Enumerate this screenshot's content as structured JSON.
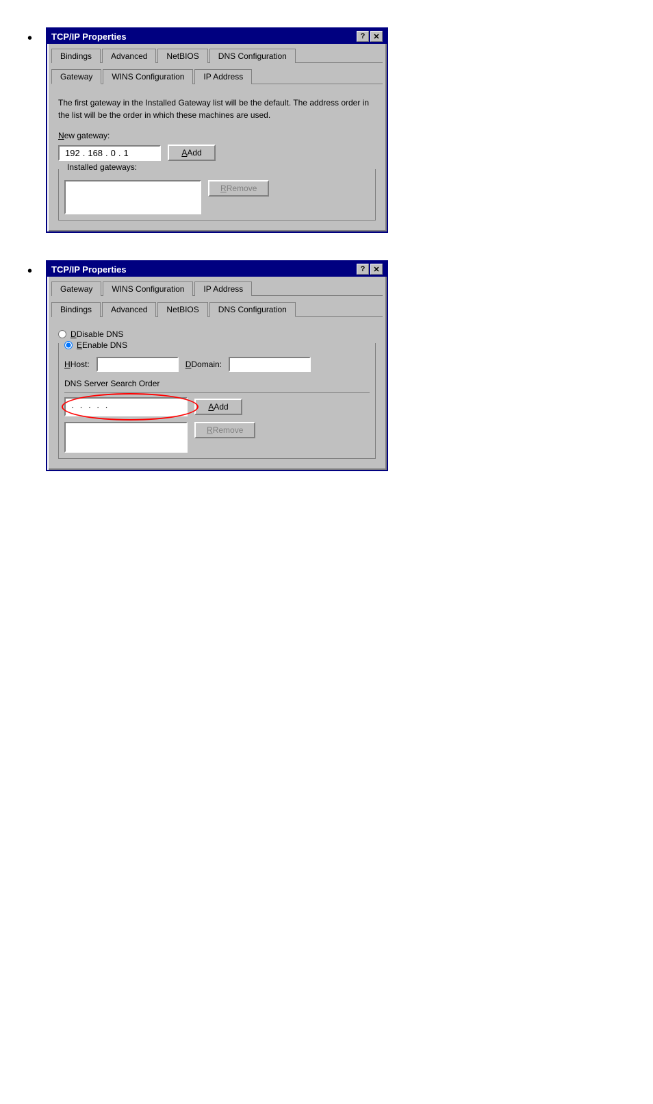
{
  "dialogs": {
    "dialog1": {
      "title": "TCP/IP Properties",
      "tabs_row1": [
        "Bindings",
        "Advanced",
        "NetBIOS",
        "DNS Configuration"
      ],
      "tabs_row2": [
        "Gateway",
        "WINS Configuration",
        "IP Address"
      ],
      "description": "The first gateway in the Installed Gateway list will be the default. The address order in the list will be the order in which these machines are used.",
      "new_gateway_label": "New gateway:",
      "ip_parts": [
        "192",
        "168",
        "0",
        "1"
      ],
      "add_button": "Add",
      "installed_gateways_label": "Installed gateways:",
      "remove_button": "Remove",
      "active_tab": "Gateway"
    },
    "dialog2": {
      "title": "TCP/IP Properties",
      "tabs_row1": [
        "Gateway",
        "WINS Configuration",
        "IP Address"
      ],
      "tabs_row2": [
        "Bindings",
        "Advanced",
        "NetBIOS",
        "DNS Configuration"
      ],
      "disable_dns_label": "Disable DNS",
      "enable_dns_label": "Enable DNS",
      "host_label": "Host:",
      "domain_label": "Domain:",
      "dns_search_order_label": "DNS Server Search Order",
      "dns_dots": [
        "·",
        "·",
        "·"
      ],
      "add_button": "Add",
      "remove_button": "Remove",
      "active_tab": "DNS Configuration"
    }
  }
}
